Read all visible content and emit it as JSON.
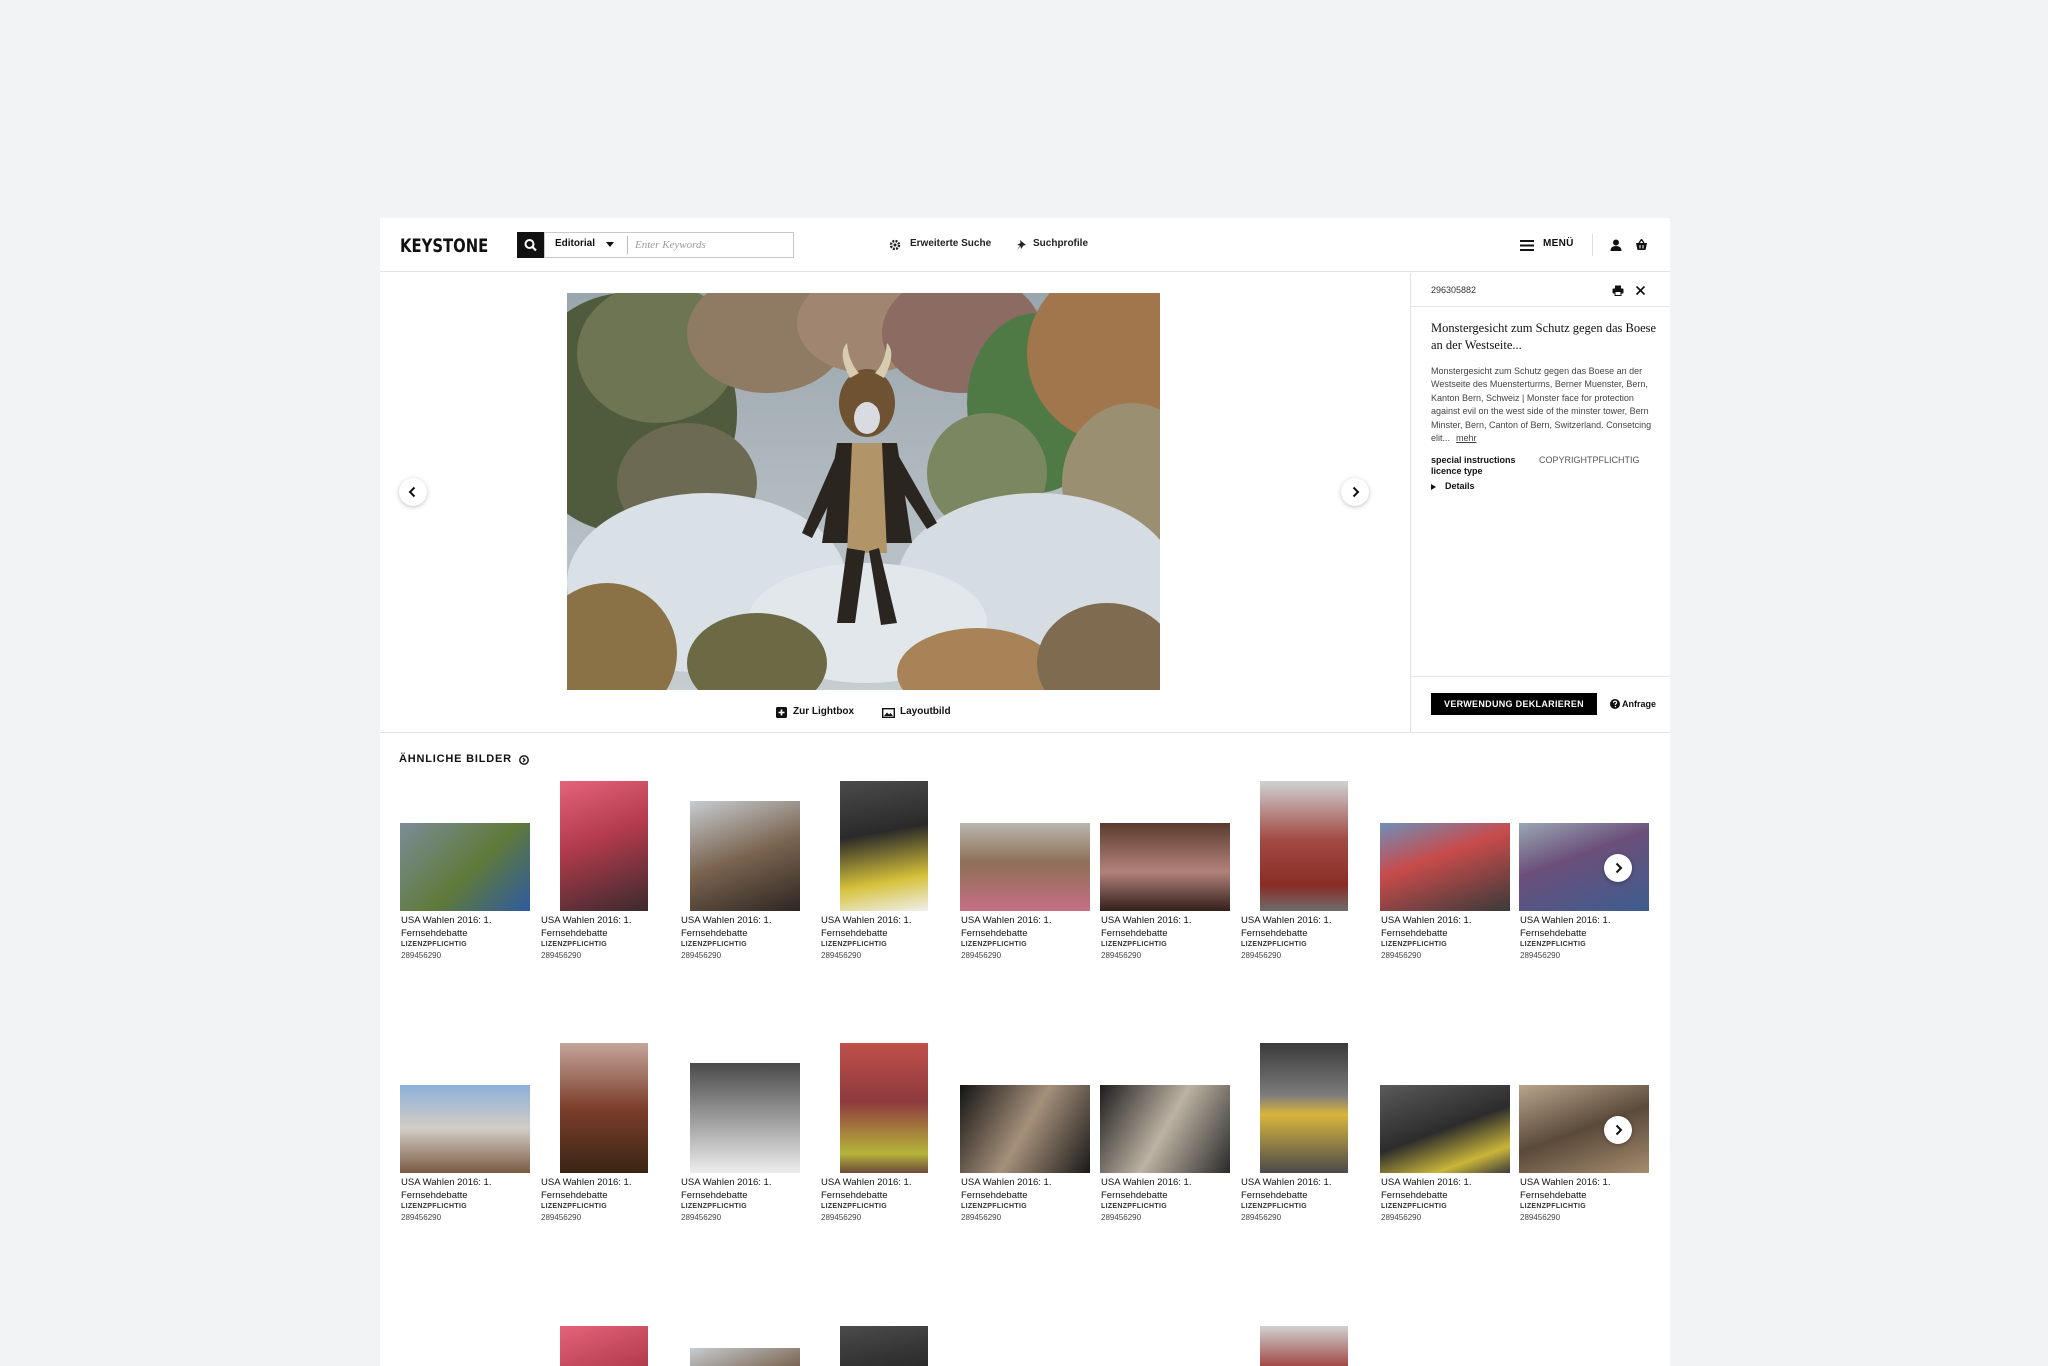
{
  "header": {
    "logo": "KEYSTONE",
    "search_scope": "Editorial",
    "search_placeholder": "Enter Keywords",
    "advanced_search": "Erweiterte Suche",
    "search_profiles": "Suchprofile",
    "menu": "MENÜ"
  },
  "viewer": {
    "actions": {
      "lightbox": "Zur Lightbox",
      "layout": "Layoutbild"
    }
  },
  "panel": {
    "id": "296305882",
    "title": "Monstergesicht zum Schutz gegen das Boese an der Westseite...",
    "description": "Monstergesicht zum Schutz gegen das Boese an der Westseite des Muensterturms, Berner Muenster, Bern, Kanton Bern, Schweiz | Monster face for protection against evil on the west side of the minster tower, Bern Minster, Bern, Canton of Bern, Switzerland. Consetcing elit...",
    "more": "mehr",
    "special_label": "special instructions",
    "special_value": "COPYRIGHTPFLICHTIG",
    "licence_label": "licence type",
    "details": "Details",
    "declare": "VERWENDUNG DEKLARIEREN",
    "request": "Anfrage"
  },
  "similar": {
    "title": "ÄHNLICHE BILDER",
    "rows": [
      [
        {
          "title": "USA Wahlen 2016: 1. Fernsehdebatte",
          "status": "LIZENZPFLICHTIG",
          "id": "289456290"
        },
        {
          "title": "USA Wahlen 2016: 1. Fernsehdebatte",
          "status": "LIZENZPFLICHTIG",
          "id": "289456290"
        },
        {
          "title": "USA Wahlen 2016: 1. Fernsehdebatte",
          "status": "LIZENZPFLICHTIG",
          "id": "289456290"
        },
        {
          "title": "USA Wahlen 2016: 1. Fernsehdebatte",
          "status": "LIZENZPFLICHTIG",
          "id": "289456290"
        },
        {
          "title": "USA Wahlen 2016: 1. Fernsehdebatte",
          "status": "LIZENZPFLICHTIG",
          "id": "289456290"
        },
        {
          "title": "USA Wahlen 2016: 1. Fernsehdebatte",
          "status": "LIZENZPFLICHTIG",
          "id": "289456290"
        },
        {
          "title": "USA Wahlen 2016: 1. Fernsehdebatte",
          "status": "LIZENZPFLICHTIG",
          "id": "289456290"
        },
        {
          "title": "USA Wahlen 2016: 1. Fernsehdebatte",
          "status": "LIZENZPFLICHTIG",
          "id": "289456290"
        },
        {
          "title": "USA Wahlen 2016: 1. Fernsehdebatte",
          "status": "LIZENZPFLICHTIG",
          "id": "289456290"
        }
      ],
      [
        {
          "title": "USA Wahlen 2016: 1. Fernsehdebatte",
          "status": "LIZENZPFLICHTIG",
          "id": "289456290"
        },
        {
          "title": "USA Wahlen 2016: 1. Fernsehdebatte",
          "status": "LIZENZPFLICHTIG",
          "id": "289456290"
        },
        {
          "title": "USA Wahlen 2016: 1. Fernsehdebatte",
          "status": "LIZENZPFLICHTIG",
          "id": "289456290"
        },
        {
          "title": "USA Wahlen 2016: 1. Fernsehdebatte",
          "status": "LIZENZPFLICHTIG",
          "id": "289456290"
        },
        {
          "title": "USA Wahlen 2016: 1. Fernsehdebatte",
          "status": "LIZENZPFLICHTIG",
          "id": "289456290"
        },
        {
          "title": "USA Wahlen 2016: 1. Fernsehdebatte",
          "status": "LIZENZPFLICHTIG",
          "id": "289456290"
        },
        {
          "title": "USA Wahlen 2016: 1. Fernsehdebatte",
          "status": "LIZENZPFLICHTIG",
          "id": "289456290"
        },
        {
          "title": "USA Wahlen 2016: 1. Fernsehdebatte",
          "status": "LIZENZPFLICHTIG",
          "id": "289456290"
        },
        {
          "title": "USA Wahlen 2016: 1. Fernsehdebatte",
          "status": "LIZENZPFLICHTIG",
          "id": "289456290"
        }
      ]
    ]
  },
  "colors": {
    "accent": "#000000",
    "background": "#f2f3f5",
    "panel": "#ffffff"
  },
  "icons": [
    "search-icon",
    "gear-icon",
    "pin-icon",
    "hamburger-icon",
    "user-icon",
    "basket-icon",
    "print-icon",
    "close-icon",
    "chevron-left-icon",
    "chevron-right-icon",
    "plus-square-icon",
    "image-icon",
    "help-circle-icon",
    "arrow-circle-icon"
  ]
}
